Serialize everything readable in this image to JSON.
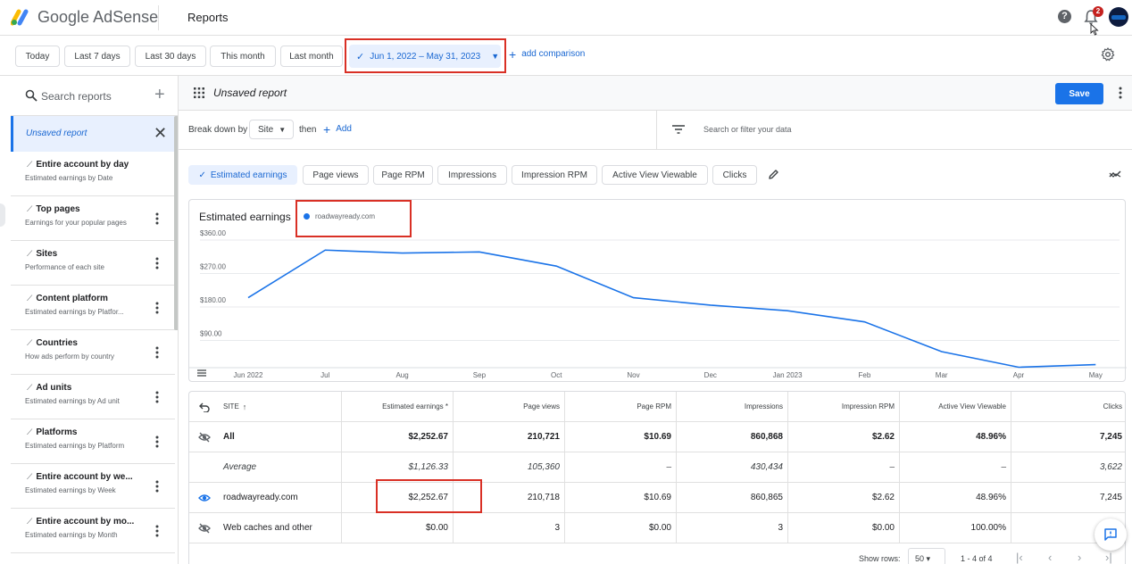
{
  "header": {
    "brand_google": "Google",
    "brand_product": "AdSense",
    "title": "Reports",
    "help_symbol": "?",
    "notification_count": "2"
  },
  "datebar": {
    "buttons": [
      "Today",
      "Last 7 days",
      "Last 30 days",
      "This month",
      "Last month"
    ],
    "selected_range": "Jun 1, 2022 – May 31, 2023",
    "add_comparison": "add comparison"
  },
  "sidebar": {
    "search_placeholder": "Search reports",
    "active_report": "Unsaved report",
    "items": [
      {
        "title": "Entire account by day",
        "subtitle": "Estimated earnings by Date"
      },
      {
        "title": "Top pages",
        "subtitle": "Earnings for your popular pages"
      },
      {
        "title": "Sites",
        "subtitle": "Performance of each site"
      },
      {
        "title": "Content platform",
        "subtitle": "Estimated earnings by Platfor..."
      },
      {
        "title": "Countries",
        "subtitle": "How ads perform by country"
      },
      {
        "title": "Ad units",
        "subtitle": "Estimated earnings by Ad unit"
      },
      {
        "title": "Platforms",
        "subtitle": "Estimated earnings by Platform"
      },
      {
        "title": "Entire account by we...",
        "subtitle": "Estimated earnings by Week"
      },
      {
        "title": "Entire account by mo...",
        "subtitle": "Estimated earnings by Month"
      }
    ]
  },
  "report": {
    "name": "Unsaved report",
    "save_label": "Save",
    "breakdown_label": "Break down by",
    "breakdown_value": "Site",
    "then_label": "then",
    "add_label": "Add",
    "filter_placeholder": "Search or filter your data",
    "metrics": [
      "Estimated earnings",
      "Page views",
      "Page RPM",
      "Impressions",
      "Impression RPM",
      "Active View Viewable",
      "Clicks"
    ],
    "active_metric": "Estimated earnings"
  },
  "chart_data": {
    "type": "line",
    "title": "Estimated earnings",
    "series": [
      {
        "name": "roadwayready.com",
        "color": "#1a73e8",
        "values": [
          205,
          333,
          325,
          328,
          290,
          205,
          185,
          170,
          140,
          60,
          18,
          25
        ]
      }
    ],
    "x": [
      "Jun 2022",
      "Jul",
      "Aug",
      "Sep",
      "Oct",
      "Nov",
      "Dec",
      "Jan 2023",
      "Feb",
      "Mar",
      "Apr",
      "May"
    ],
    "y_ticks": [
      "$90.00",
      "$180.00",
      "$270.00",
      "$360.00"
    ],
    "ylim": [
      0,
      360
    ],
    "grid": true
  },
  "table": {
    "columns": [
      "SITE",
      "Estimated earnings *",
      "Page views",
      "Page RPM",
      "Impressions",
      "Impression RPM",
      "Active View Viewable",
      "Clicks"
    ],
    "rows": [
      {
        "site": "All",
        "values": [
          "$2,252.67",
          "210,721",
          "$10.69",
          "860,868",
          "$2.62",
          "48.96%",
          "7,245"
        ]
      },
      {
        "site": "Average",
        "values": [
          "$1,126.33",
          "105,360",
          "–",
          "430,434",
          "–",
          "–",
          "3,622"
        ]
      },
      {
        "site": "roadwayready.com",
        "values": [
          "$2,252.67",
          "210,718",
          "$10.69",
          "860,865",
          "$2.62",
          "48.96%",
          "7,245"
        ]
      },
      {
        "site": "Web caches and other",
        "values": [
          "$0.00",
          "3",
          "$0.00",
          "3",
          "$0.00",
          "100.00%",
          ""
        ]
      }
    ]
  },
  "pager": {
    "show_rows_label": "Show rows:",
    "rows_value": "50",
    "range": "1 - 4 of 4"
  }
}
